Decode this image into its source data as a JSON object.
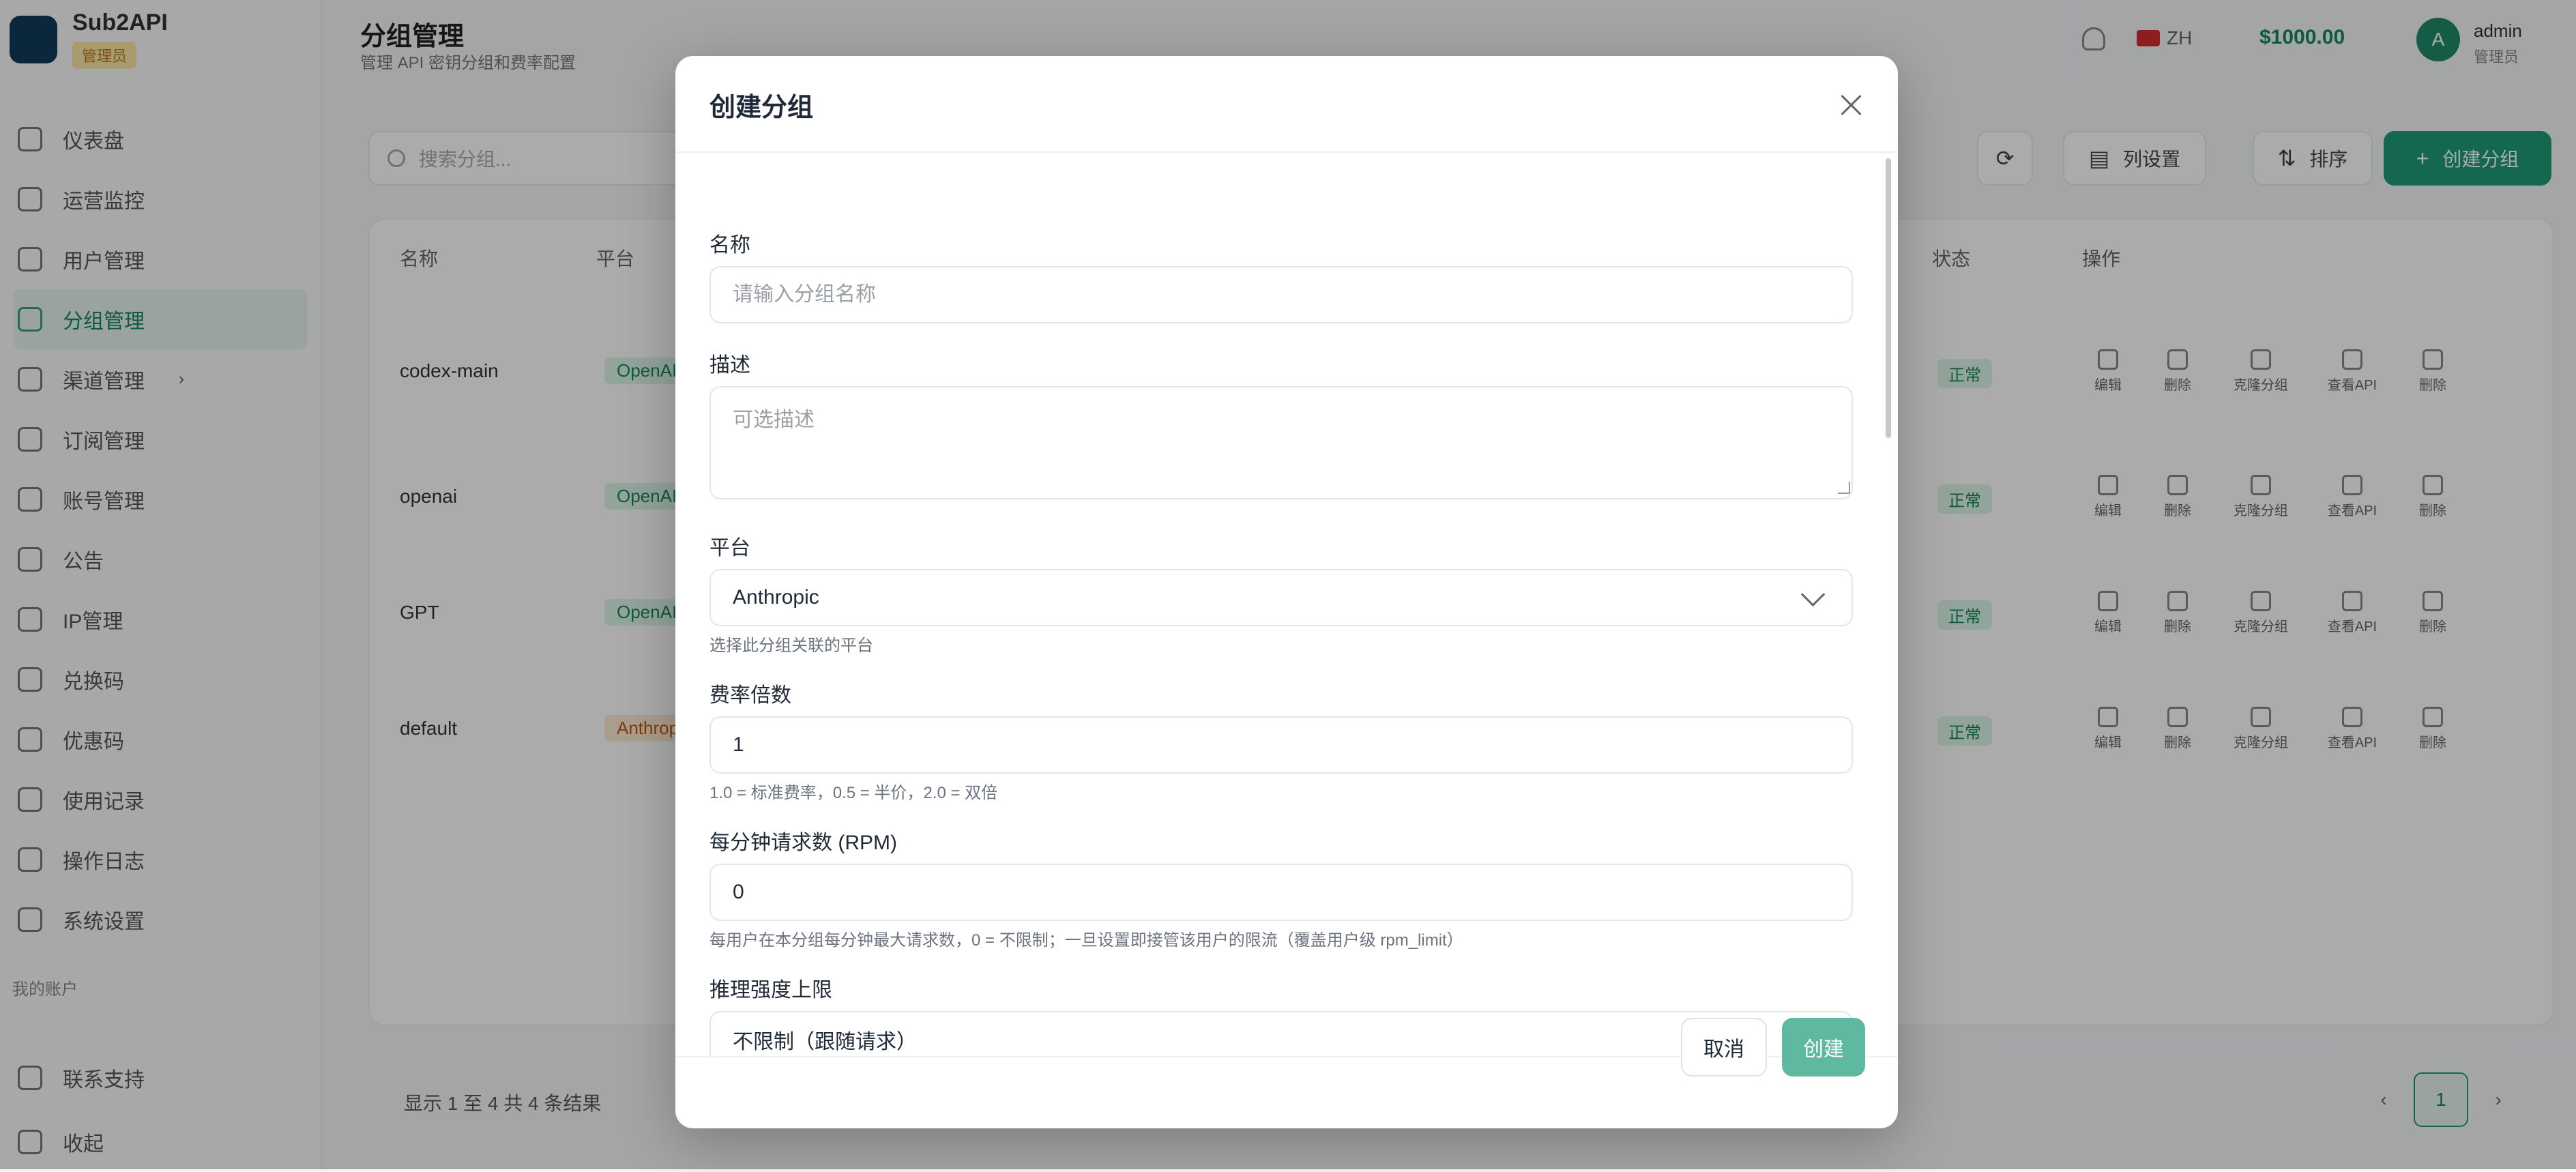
{
  "app": {
    "brand": "Sub2API",
    "brand_badge": "管理员"
  },
  "sidebar": {
    "items": [
      {
        "label": "仪表盘"
      },
      {
        "label": "运营监控"
      },
      {
        "label": "用户管理"
      },
      {
        "label": "分组管理",
        "active": true
      },
      {
        "label": "渠道管理",
        "caret": "›"
      },
      {
        "label": "订阅管理"
      },
      {
        "label": "账号管理"
      },
      {
        "label": "公告"
      },
      {
        "label": "IP管理"
      },
      {
        "label": "兑换码"
      },
      {
        "label": "优惠码"
      },
      {
        "label": "使用记录"
      },
      {
        "label": "操作日志"
      },
      {
        "label": "系统设置"
      }
    ],
    "section_label": "我的账户",
    "bottom": [
      {
        "label": "联系支持"
      },
      {
        "label": "收起"
      }
    ]
  },
  "topbar": {
    "title": "分组管理",
    "subtitle": "管理 API 密钥分组和费率配置",
    "lang": "ZH",
    "balance": "$1000.00",
    "avatar": "A",
    "user": "admin",
    "role": "管理员"
  },
  "toolbar": {
    "search_placeholder": "搜索分组...",
    "sort_label": "列设置",
    "usage_label": "排序",
    "create_label": "创建分组"
  },
  "table": {
    "headers": [
      "名称",
      "平台",
      "状态",
      "操作"
    ],
    "rows": [
      {
        "name": "codex-main",
        "platform": "OpenAI",
        "status": "正常"
      },
      {
        "name": "openai",
        "platform": "OpenAI",
        "status": "正常"
      },
      {
        "name": "GPT",
        "platform": "OpenAI",
        "status": "正常"
      },
      {
        "name": "default",
        "platform": "Anthropic",
        "status": "正常"
      }
    ],
    "actions": [
      "编辑",
      "删除",
      "克隆分组",
      "查看API",
      "删除"
    ],
    "footer": "显示 1 至 4 共 4 条结果",
    "page": "1"
  },
  "modal": {
    "title": "创建分组",
    "name_label": "名称",
    "name_placeholder": "请输入分组名称",
    "name_value": "",
    "desc_label": "描述",
    "desc_placeholder": "可选描述",
    "platform_label": "平台",
    "platform_value": "Anthropic",
    "platform_help": "选择此分组关联的平台",
    "rate_label": "费率倍数",
    "rate_value": "1",
    "rate_help": "1.0 = 标准费率，0.5 = 半价，2.0 = 双倍",
    "rpm_label": "每分钟请求数 (RPM)",
    "rpm_value": "0",
    "rpm_help": "每用户在本分组每分钟最大请求数，0 = 不限制；一旦设置即接管该用户的限流（覆盖用户级 rpm_limit）",
    "reasoning_label": "推理强度上限",
    "reasoning_value": "不限制（跟随请求）",
    "cancel_label": "取消",
    "create_label": "创建"
  },
  "colors": {
    "accent": "#1f9b78",
    "primary_button": "#5fb8a0",
    "overlay": "rgba(0,0,0,0.33)"
  },
  "icons": {
    "close": "close-icon",
    "select": "chevron-down-icon"
  }
}
